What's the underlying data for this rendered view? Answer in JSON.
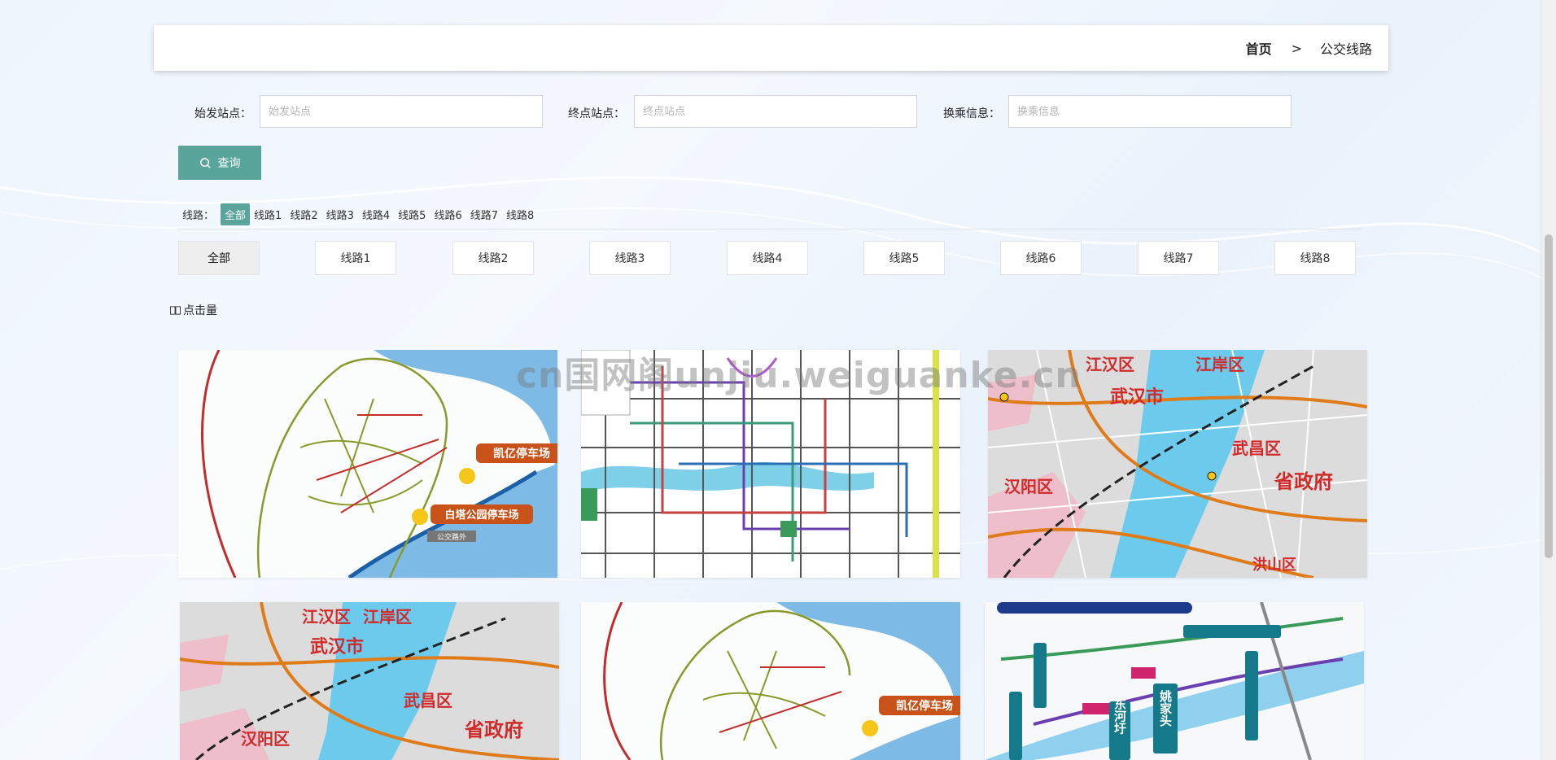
{
  "breadcrumb": {
    "home": "首页",
    "separator": ">",
    "current": "公交线路"
  },
  "search": {
    "start_label": "始发站点：",
    "start_placeholder": "始发站点",
    "start_value": "",
    "end_label": "终点站点：",
    "end_placeholder": "终点站点",
    "end_value": "",
    "transfer_label": "换乘信息：",
    "transfer_placeholder": "换乘信息",
    "transfer_value": "",
    "query_button": "查询"
  },
  "filter": {
    "label": "线路：",
    "options": [
      "全部",
      "线路1",
      "线路2",
      "线路3",
      "线路4",
      "线路5",
      "线路6",
      "线路7",
      "线路8"
    ],
    "active": "全部"
  },
  "tabs": {
    "items": [
      "全部",
      "线路1",
      "线路2",
      "线路3",
      "线路4",
      "线路5",
      "线路6",
      "线路7",
      "线路8"
    ],
    "active": "全部"
  },
  "sort": {
    "label": "点击量",
    "icon": "book-icon"
  },
  "watermark": "cn国网阁unjiu.weiguanke.cn",
  "cards": [
    {
      "type": "park-map",
      "labels": [
        "凯亿停车场",
        "白塔公园停车场",
        "公交路外"
      ]
    },
    {
      "type": "route-network",
      "labels": []
    },
    {
      "type": "city-map",
      "labels": [
        "江汉区",
        "江岸区",
        "武汉市",
        "武昌区",
        "汉阳区",
        "省政府",
        "洪山区"
      ]
    },
    {
      "type": "city-map",
      "labels": [
        "江汉区",
        "江岸区",
        "武汉市",
        "武昌区",
        "汉阳区",
        "省政府"
      ]
    },
    {
      "type": "park-map",
      "labels": [
        "凯亿停车场"
      ]
    },
    {
      "type": "station-map",
      "labels": [
        "东河圩",
        "姚家头"
      ]
    }
  ],
  "colors": {
    "accent": "#5aa59b",
    "water": "#2a6fb5",
    "road": "#e07b1a"
  }
}
